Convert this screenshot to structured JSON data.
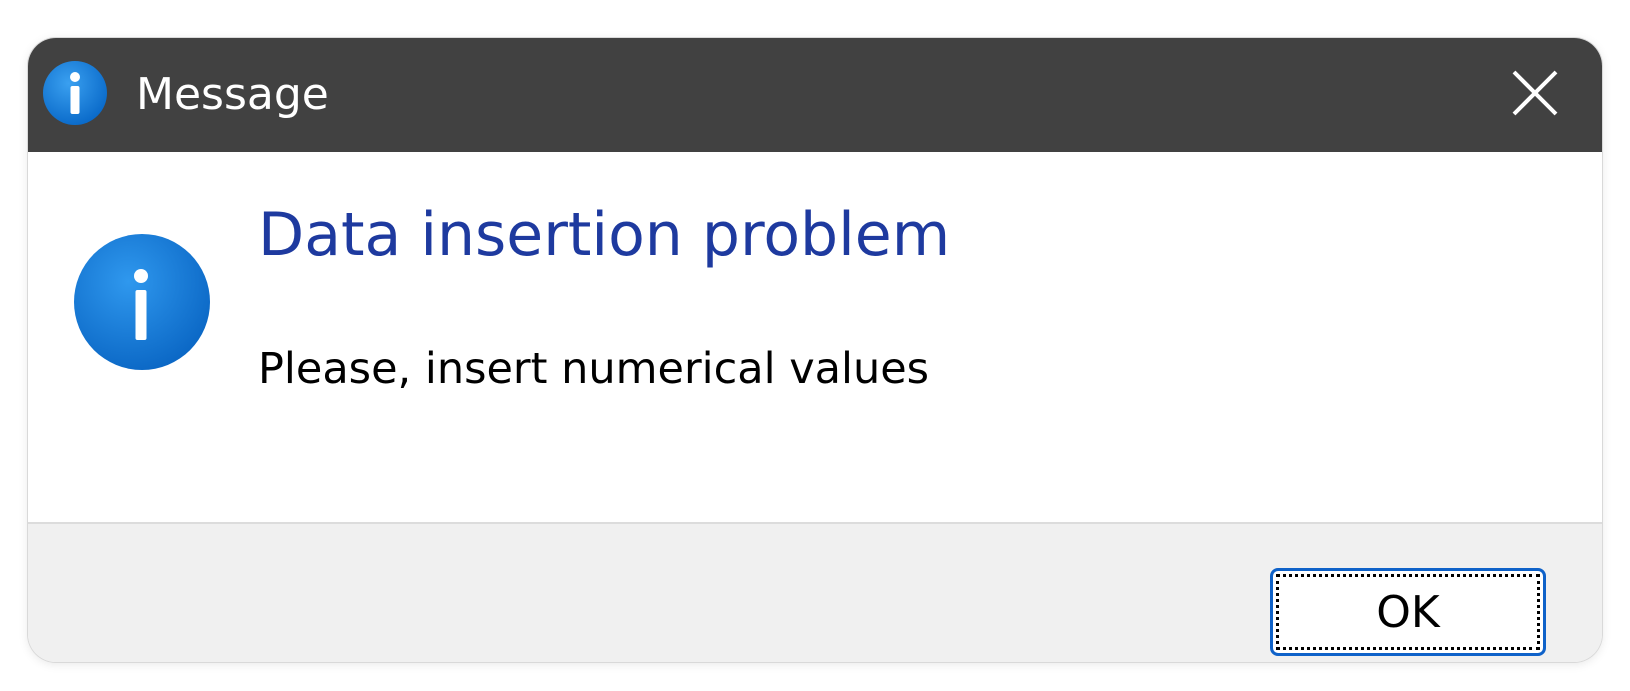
{
  "window": {
    "title": "Message",
    "title_icon": "info-icon",
    "close_icon": "close-icon"
  },
  "content": {
    "icon": "info-icon",
    "heading": "Data insertion problem",
    "message": "Please, insert numerical values"
  },
  "footer": {
    "ok_label": "OK"
  },
  "colors": {
    "titlebar_bg": "#414141",
    "heading_text": "#1e3a9f",
    "info_icon": "#0a74da",
    "ok_border": "#0f62c9",
    "footer_bg": "#f0f0f0"
  }
}
